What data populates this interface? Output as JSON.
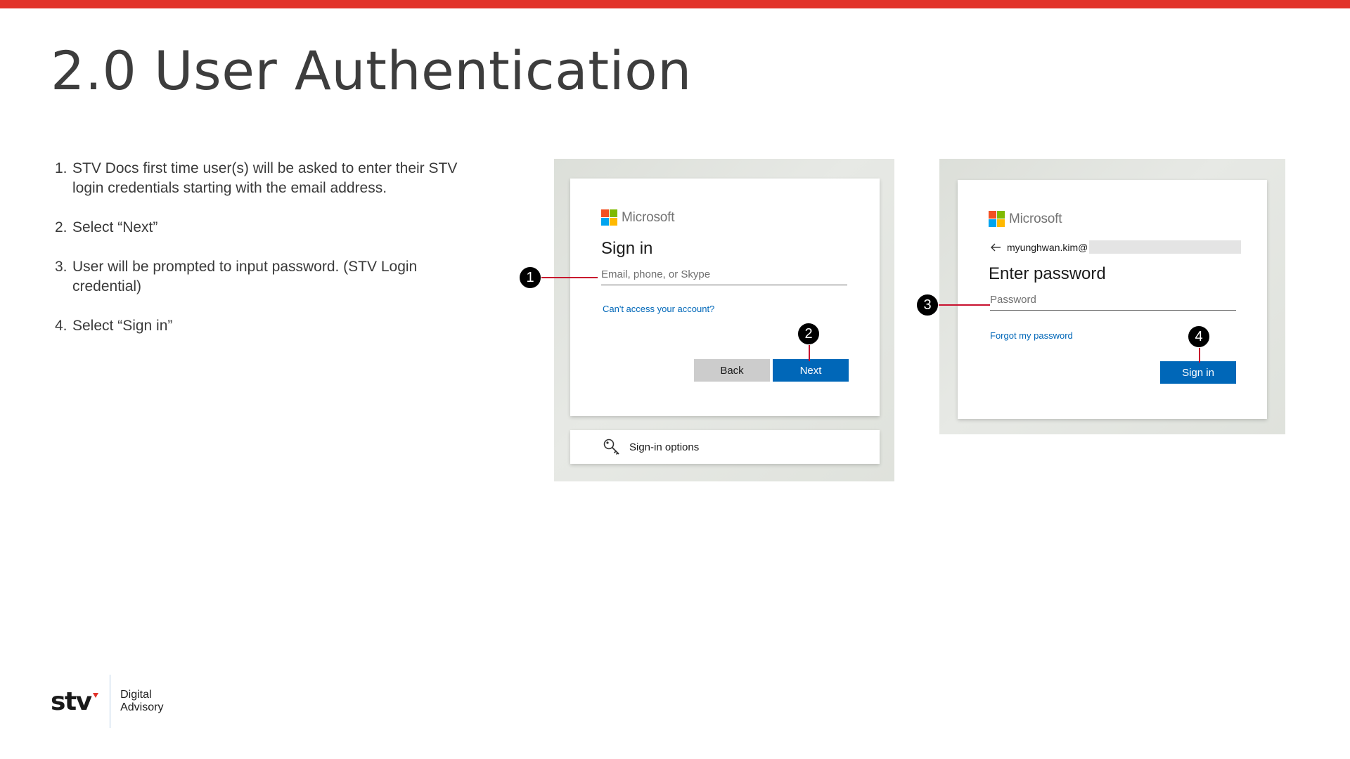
{
  "slide": {
    "title": "2.0 User Authentication",
    "accent_color": "#e2332a"
  },
  "steps": [
    {
      "num": "1.",
      "text": "STV Docs first time user(s) will be asked to enter their STV login credentials starting with the email address."
    },
    {
      "num": "2.",
      "text": "Select “Next”"
    },
    {
      "num": "3.",
      "text": "User will be prompted to input password. (STV Login credential)"
    },
    {
      "num": "4.",
      "text": "Select “Sign in”"
    }
  ],
  "signin_screen": {
    "brand": "Microsoft",
    "heading": "Sign in",
    "email_placeholder": "Email, phone, or Skype",
    "cant_access_link": "Can't access your account?",
    "back_label": "Back",
    "next_label": "Next",
    "options_label": "Sign-in options",
    "icons": {
      "options": "key-search-icon"
    }
  },
  "password_screen": {
    "brand": "Microsoft",
    "account": "myunghwan.kim@",
    "heading": "Enter password",
    "password_placeholder": "Password",
    "forgot_link": "Forgot my password",
    "signin_label": "Sign in",
    "icons": {
      "back": "back-arrow-icon"
    }
  },
  "callouts": [
    "1",
    "2",
    "3",
    "4"
  ],
  "footer": {
    "logo_text": "stv",
    "line1": "Digital",
    "line2": "Advisory"
  },
  "colors": {
    "primary_button": "#0067b8",
    "secondary_button": "#cccccc",
    "callout_line": "#c8102e",
    "link": "#0067b8"
  }
}
